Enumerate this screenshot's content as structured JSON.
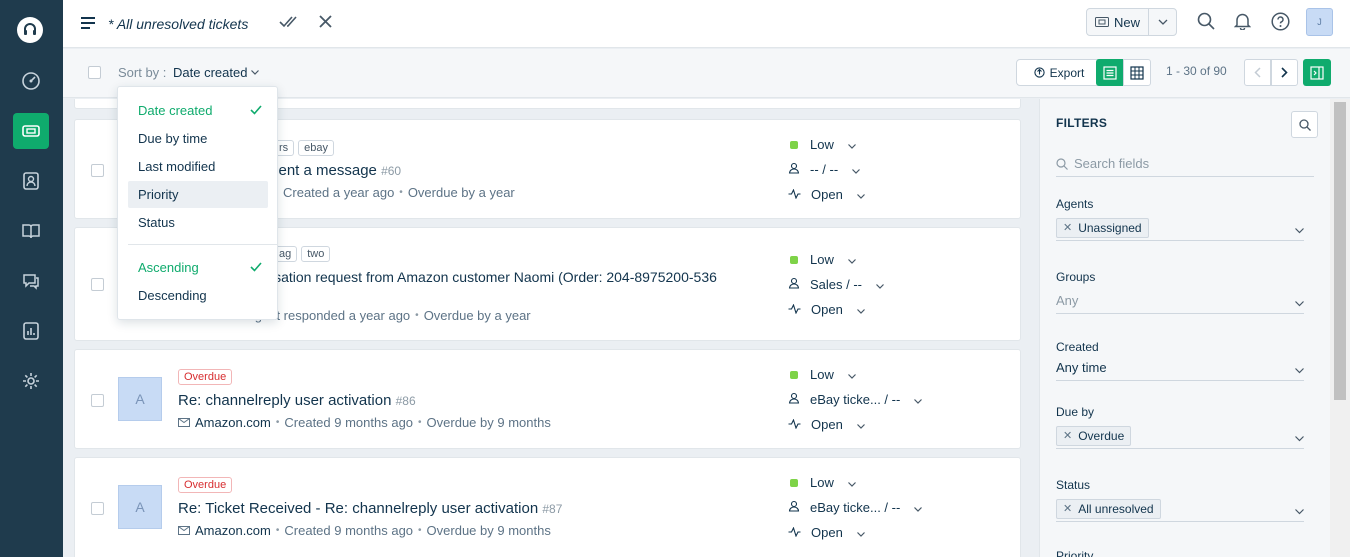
{
  "header": {
    "view_title": "* All unresolved tickets",
    "new_label": "New",
    "avatar_initial": "J"
  },
  "toolbar": {
    "sort_by_label": "Sort by :",
    "sort_value": "Date created",
    "export_label": "Export",
    "pagination": "1 - 30 of 90"
  },
  "sort_menu": {
    "fields": [
      "Date created",
      "Due by time",
      "Last modified",
      "Priority",
      "Status"
    ],
    "selected_field": "Date created",
    "hovered_field": "Priority",
    "orders": [
      "Ascending",
      "Descending"
    ],
    "selected_order": "Ascending"
  },
  "tickets": [
    {
      "tags": [
        "rs",
        "ebay"
      ],
      "subject": "sent a message",
      "number": "#60",
      "meta": [
        "Created a year ago",
        "Overdue by a year"
      ],
      "priority": "Low",
      "assignee": "-- / --",
      "status": "Open"
    },
    {
      "tags": [
        "ag",
        "two"
      ],
      "subject": "isation request from Amazon customer Naomi (Order: 204-8975200-536",
      "number": "",
      "requester": "Naomi",
      "meta": [
        "Agent responded a year ago",
        "Overdue by a year"
      ],
      "priority": "Low",
      "assignee": "Sales / --",
      "status": "Open"
    },
    {
      "avatar": "A",
      "badge": "Overdue",
      "subject": "Re: channelreply user activation",
      "number": "#86",
      "requester": "Amazon.com",
      "meta": [
        "Created 9 months ago",
        "Overdue by 9 months"
      ],
      "priority": "Low",
      "assignee": "eBay ticke... / --",
      "status": "Open"
    },
    {
      "avatar": "A",
      "badge": "Overdue",
      "subject": "Re: Ticket Received - Re: channelreply user activation",
      "number": "#87",
      "requester": "Amazon.com",
      "meta": [
        "Created 9 months ago",
        "Overdue by 9 months"
      ],
      "priority": "Low",
      "assignee": "eBay ticke... / --",
      "status": "Open"
    }
  ],
  "filters": {
    "title": "FILTERS",
    "search_placeholder": "Search fields",
    "agents_label": "Agents",
    "agents_value": "Unassigned",
    "groups_label": "Groups",
    "groups_value": "Any",
    "created_label": "Created",
    "created_value": "Any time",
    "dueby_label": "Due by",
    "dueby_value": "Overdue",
    "status_label": "Status",
    "status_value": "All unresolved",
    "priority_label": "Priority"
  },
  "colors": {
    "nav_bg": "#1f3b4d",
    "accent": "#0fab6d",
    "priority_low": "#7ed348",
    "overdue": "#d72d30"
  }
}
